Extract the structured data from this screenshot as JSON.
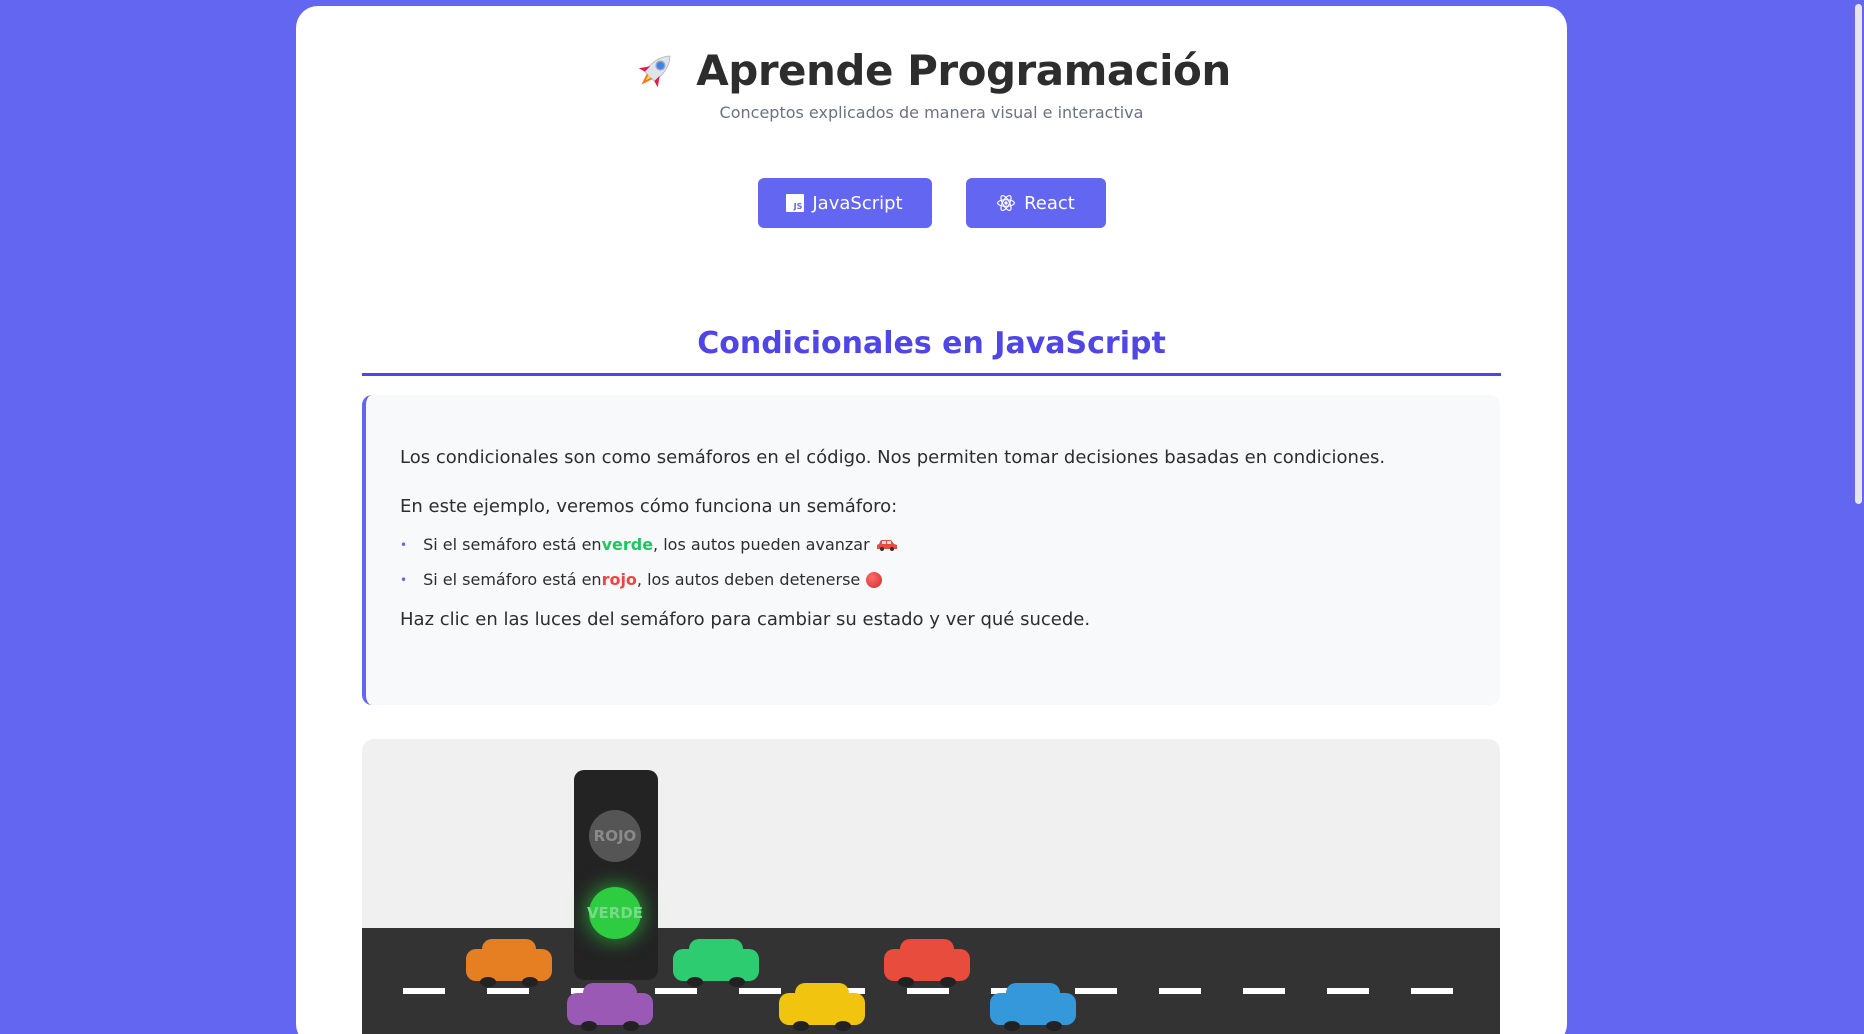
{
  "app": {
    "title": "Aprende Programación",
    "subtitle": "Conceptos explicados de manera visual e interactiva"
  },
  "tech_buttons": [
    {
      "label": "JavaScript",
      "icon": "js-icon"
    },
    {
      "label": "React",
      "icon": "react-atom-icon"
    }
  ],
  "section": {
    "title": "Condicionales en JavaScript"
  },
  "explanation": {
    "p1": "Los condicionales son como semáforos en el código. Nos permiten tomar decisiones basadas en condiciones.",
    "p2": "En este ejemplo, veremos cómo funciona un semáforo:",
    "bullet_green": {
      "before": "Si el semáforo está en ",
      "word": "verde",
      "after": ", los autos pueden avanzar"
    },
    "bullet_red": {
      "before": "Si el semáforo está en ",
      "word": "rojo",
      "after": ", los autos deben detenerse"
    },
    "p3": "Haz clic en las luces del semáforo para cambiar su estado y ver qué sucede."
  },
  "traffic_light": {
    "red_label": "ROJO",
    "green_label": "VERDE",
    "active": "verde"
  },
  "colors": {
    "background": "#6366f1",
    "accent": "#4f46e5",
    "green": "#22c55e",
    "red": "#ef4444",
    "road": "#333333"
  },
  "cars": [
    {
      "color": "#e67e22"
    },
    {
      "color": "#9b59b6"
    },
    {
      "color": "#2ecc71"
    },
    {
      "color": "#f1c40f"
    },
    {
      "color": "#e74c3c"
    },
    {
      "color": "#3498db"
    }
  ]
}
